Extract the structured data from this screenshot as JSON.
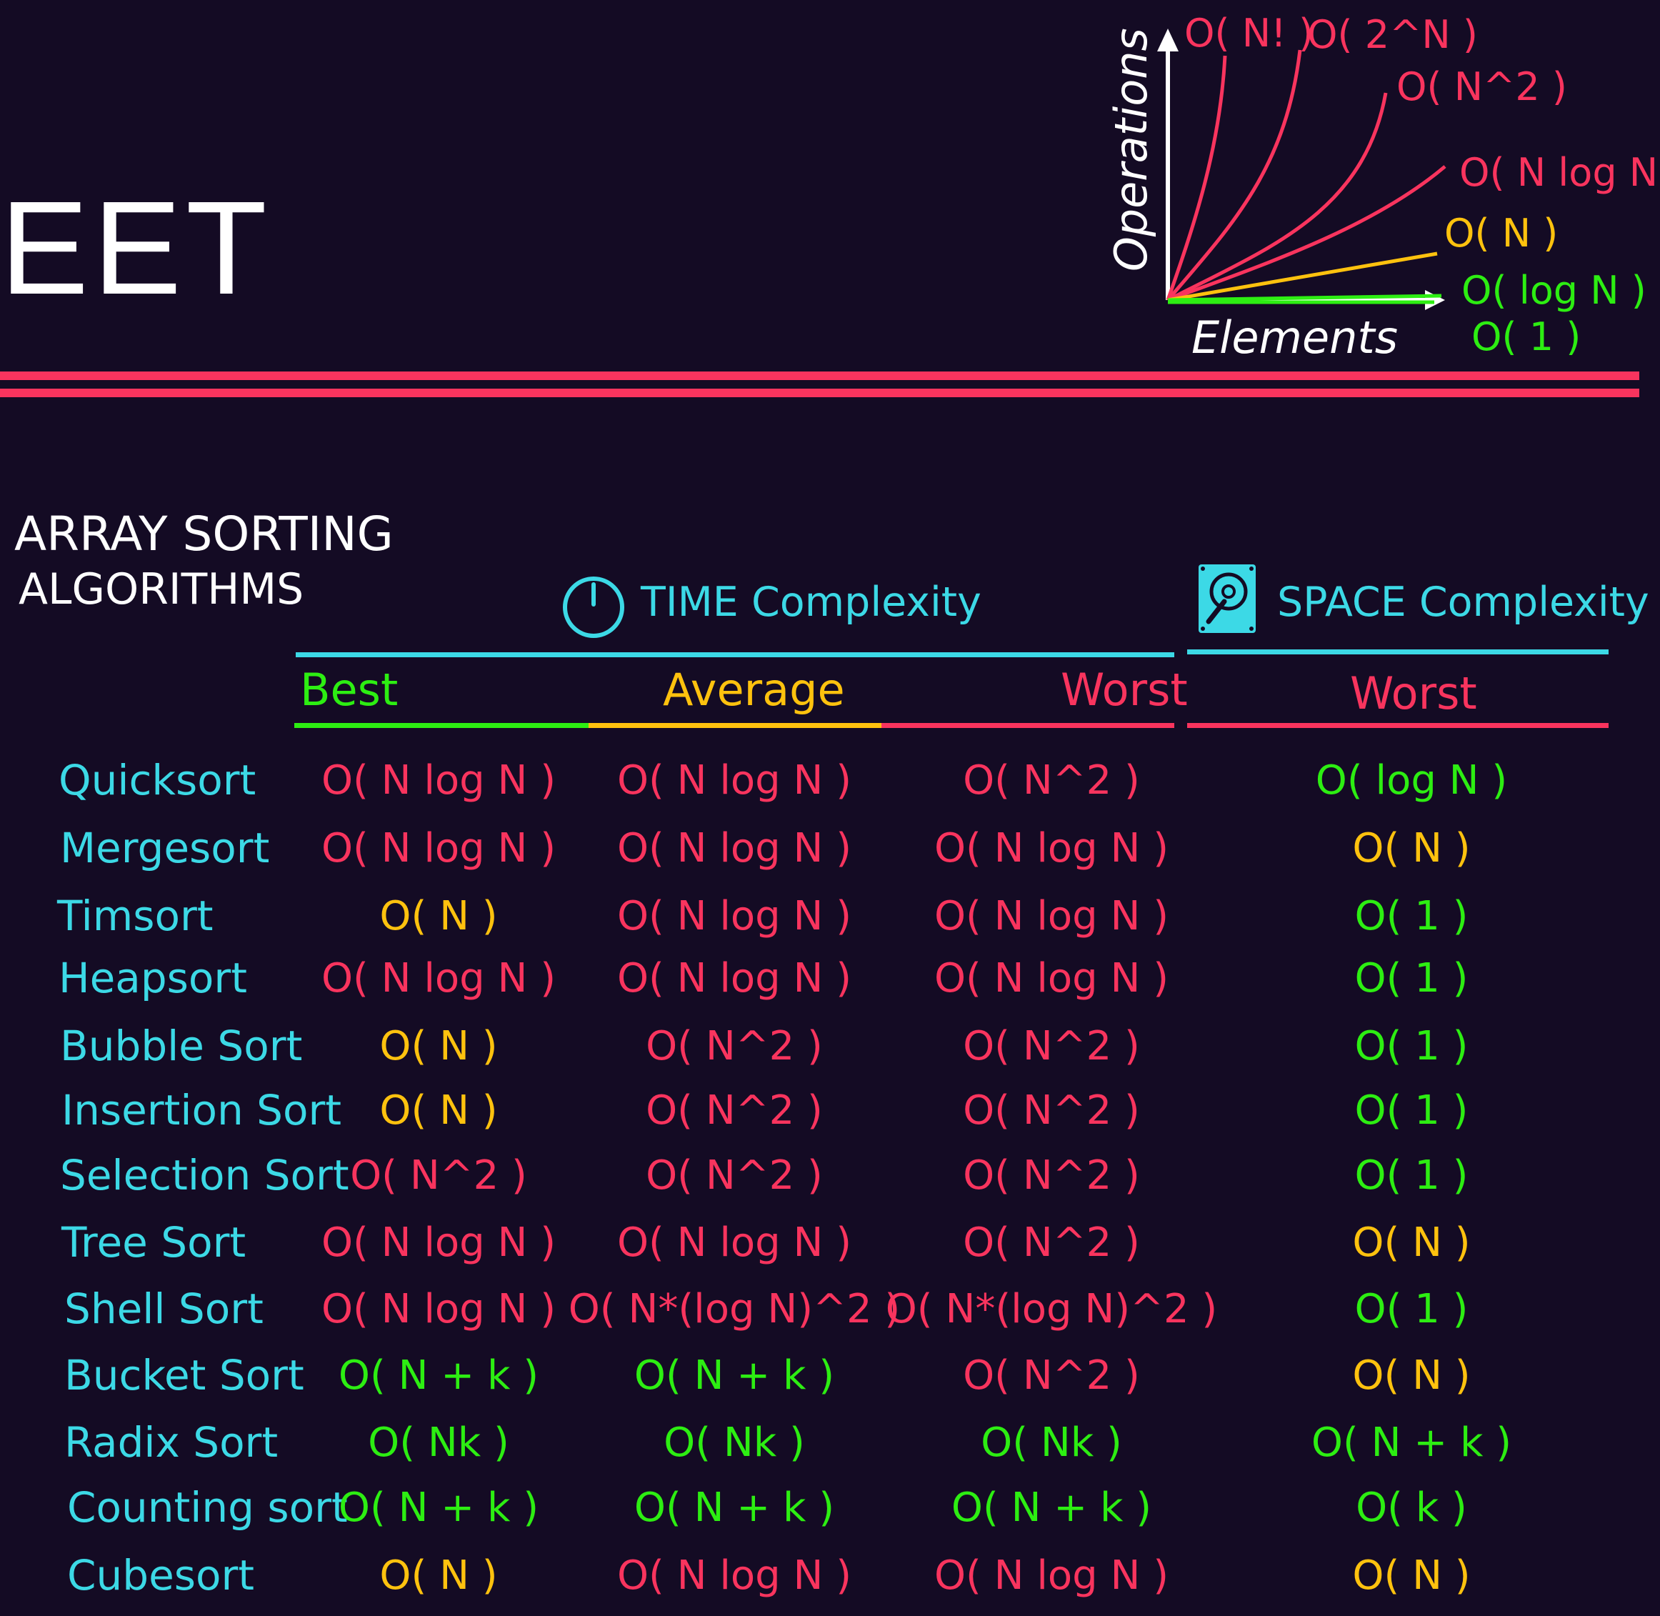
{
  "title": {
    "fragment": "EET"
  },
  "complexity_chart": {
    "y_axis_label": "Operations",
    "x_axis_label": "Elements",
    "curves": [
      {
        "label": "O( N! )",
        "color": "#f9345e"
      },
      {
        "label": "O( 2^N )",
        "color": "#f9345e"
      },
      {
        "label": "O( N^2 )",
        "color": "#f9345e"
      },
      {
        "label": "O( N log N )",
        "color": "#f9345e"
      },
      {
        "label": "O( N )",
        "color": "#ffc20e"
      },
      {
        "label": "O( log N )",
        "color": "#2dee12"
      },
      {
        "label": "O( 1 )",
        "color": "#2dee12"
      }
    ]
  },
  "section": {
    "title_line1": "ARRAY SORTING",
    "title_line2": "ALGORITHMS",
    "time_header": "TIME Complexity",
    "space_header": "SPACE Complexity",
    "time_icon": "stopwatch-icon",
    "space_icon": "hard-disk-icon"
  },
  "columns": {
    "best": "Best",
    "average": "Average",
    "worst": "Worst",
    "space_worst": "Worst"
  },
  "colors": {
    "red": "#f9345e",
    "yellow": "#ffc20e",
    "green": "#2dee12",
    "cyan": "#3cd9e6",
    "background": "#140b24"
  },
  "rows": [
    {
      "name": "Quicksort",
      "best": "O( N log N )",
      "best_c": "red",
      "avg": "O( N log N )",
      "avg_c": "red",
      "worst": "O( N^2 )",
      "worst_c": "red",
      "space": "O( log N )",
      "space_c": "green"
    },
    {
      "name": "Mergesort",
      "best": "O( N log N )",
      "best_c": "red",
      "avg": "O( N log N )",
      "avg_c": "red",
      "worst": "O( N log N )",
      "worst_c": "red",
      "space": "O( N )",
      "space_c": "yellow"
    },
    {
      "name": "Timsort",
      "best": "O( N )",
      "best_c": "yellow",
      "avg": "O( N log N )",
      "avg_c": "red",
      "worst": "O( N log N )",
      "worst_c": "red",
      "space": "O( 1 )",
      "space_c": "green"
    },
    {
      "name": "Heapsort",
      "best": "O( N log N )",
      "best_c": "red",
      "avg": "O( N log N )",
      "avg_c": "red",
      "worst": "O( N log N )",
      "worst_c": "red",
      "space": "O( 1 )",
      "space_c": "green"
    },
    {
      "name": "Bubble Sort",
      "best": "O( N )",
      "best_c": "yellow",
      "avg": "O( N^2 )",
      "avg_c": "red",
      "worst": "O( N^2 )",
      "worst_c": "red",
      "space": "O( 1 )",
      "space_c": "green"
    },
    {
      "name": "Insertion Sort",
      "best": "O( N )",
      "best_c": "yellow",
      "avg": "O( N^2 )",
      "avg_c": "red",
      "worst": "O( N^2 )",
      "worst_c": "red",
      "space": "O( 1 )",
      "space_c": "green"
    },
    {
      "name": "Selection Sort",
      "best": "O( N^2 )",
      "best_c": "red",
      "avg": "O( N^2 )",
      "avg_c": "red",
      "worst": "O( N^2 )",
      "worst_c": "red",
      "space": "O( 1 )",
      "space_c": "green"
    },
    {
      "name": "Tree Sort",
      "best": "O( N log N )",
      "best_c": "red",
      "avg": "O( N log N )",
      "avg_c": "red",
      "worst": "O( N^2 )",
      "worst_c": "red",
      "space": "O( N )",
      "space_c": "yellow"
    },
    {
      "name": "Shell Sort",
      "best": "O( N log N )",
      "best_c": "red",
      "avg": "O( N*(log N)^2 )",
      "avg_c": "red",
      "worst": "O( N*(log N)^2 )",
      "worst_c": "red",
      "space": "O( 1 )",
      "space_c": "green"
    },
    {
      "name": "Bucket Sort",
      "best": "O( N + k )",
      "best_c": "green",
      "avg": "O( N + k )",
      "avg_c": "green",
      "worst": "O( N^2 )",
      "worst_c": "red",
      "space": "O( N )",
      "space_c": "yellow"
    },
    {
      "name": "Radix Sort",
      "best": "O( Nk )",
      "best_c": "green",
      "avg": "O( Nk )",
      "avg_c": "green",
      "worst": "O( Nk )",
      "worst_c": "green",
      "space": "O( N + k )",
      "space_c": "green"
    },
    {
      "name": "Counting sort",
      "best": "O( N + k )",
      "best_c": "green",
      "avg": "O( N + k )",
      "avg_c": "green",
      "worst": "O( N + k )",
      "worst_c": "green",
      "space": "O( k )",
      "space_c": "green"
    },
    {
      "name": "Cubesort",
      "best": "O( N )",
      "best_c": "yellow",
      "avg": "O( N log N )",
      "avg_c": "red",
      "worst": "O( N log N )",
      "worst_c": "red",
      "space": "O( N )",
      "space_c": "yellow"
    }
  ]
}
